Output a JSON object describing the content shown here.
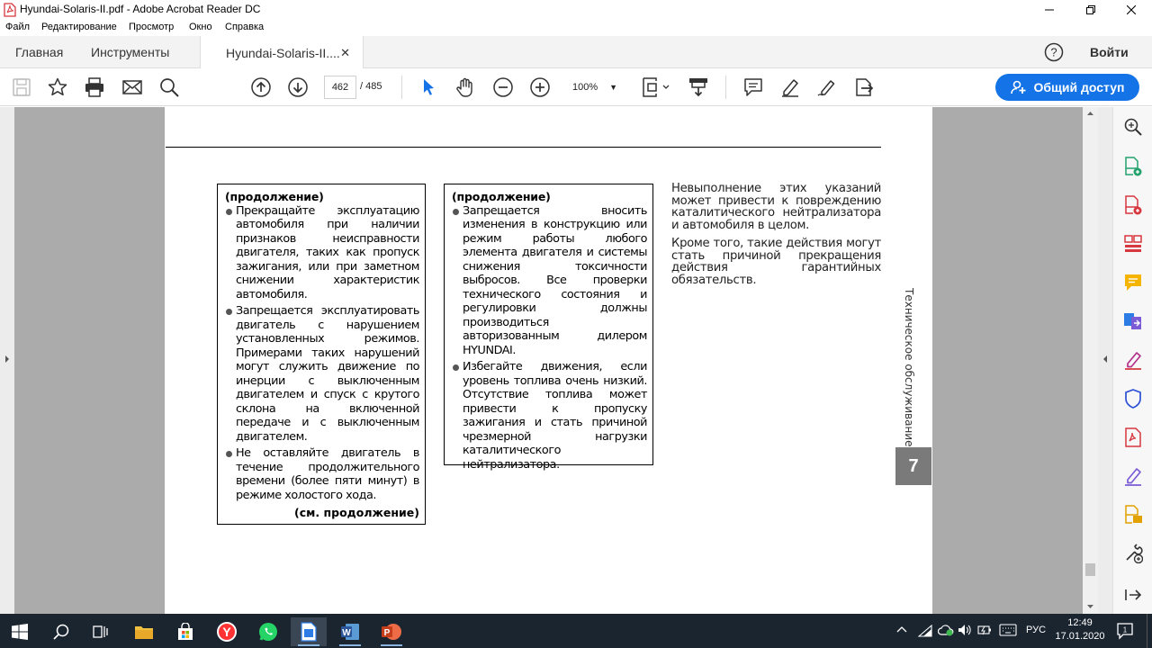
{
  "window": {
    "title": "Hyundai-Solaris-II.pdf - Adobe Acrobat Reader DC"
  },
  "menu": [
    "Файл",
    "Редактирование",
    "Просмотр",
    "Окно",
    "Справка"
  ],
  "tabs": {
    "home": "Главная",
    "tools": "Инструменты",
    "document": "Hyundai-Solaris-II....",
    "signin": "Войти"
  },
  "toolbar": {
    "page_current": "462",
    "page_total": "/ 485",
    "zoom": "100%",
    "share_label": "Общий доступ"
  },
  "page": {
    "box1": {
      "header": "(продолжение)",
      "items": [
        "Прекращайте эксплуатацию автомобиля при наличии признаков неисправности двигателя, таких как пропуск зажигания, или при заметном снижении характеристик автомобиля.",
        "Запрещается эксплуатировать двигатель с нарушением установленных режимов. Примерами таких нарушений могут служить движение по инерции с выключенным двигателем и спуск с крутого склона на включенной передаче и с выключенным двигателем.",
        "Не оставляйте двигатель в течение продолжительного времени (более пяти минут) в режиме холостого хода."
      ],
      "footer": "(см. продолжение)"
    },
    "box2": {
      "header": "(продолжение)",
      "items": [
        "Запрещается вносить изменения в конструкцию или режим работы любого элемента двигателя и системы снижения токсичности выбросов. Все проверки технического состояния и регулировки должны производиться авторизованным дилером HYUNDAI.",
        "Избегайте движения, если уровень топлива очень низкий. Отсутствие топлива может привести к пропуску зажигания и стать причиной чрезмерной нагрузки каталитического нейтрализатора."
      ]
    },
    "col3": [
      "Невыполнение этих указаний может привести к повреждению каталитического нейтрализатора и автомобиля в целом.",
      "Кроме того, такие действия могут стать причиной прекращения действия гарантийных обязательств."
    ],
    "side_label": "Техническое обслуживание",
    "chapter": "7"
  },
  "taskbar": {
    "lang": "РУС",
    "time": "12:49",
    "date": "17.01.2020"
  },
  "colors": {
    "accent": "#1473e6",
    "acrobat_red": "#d7373f"
  }
}
